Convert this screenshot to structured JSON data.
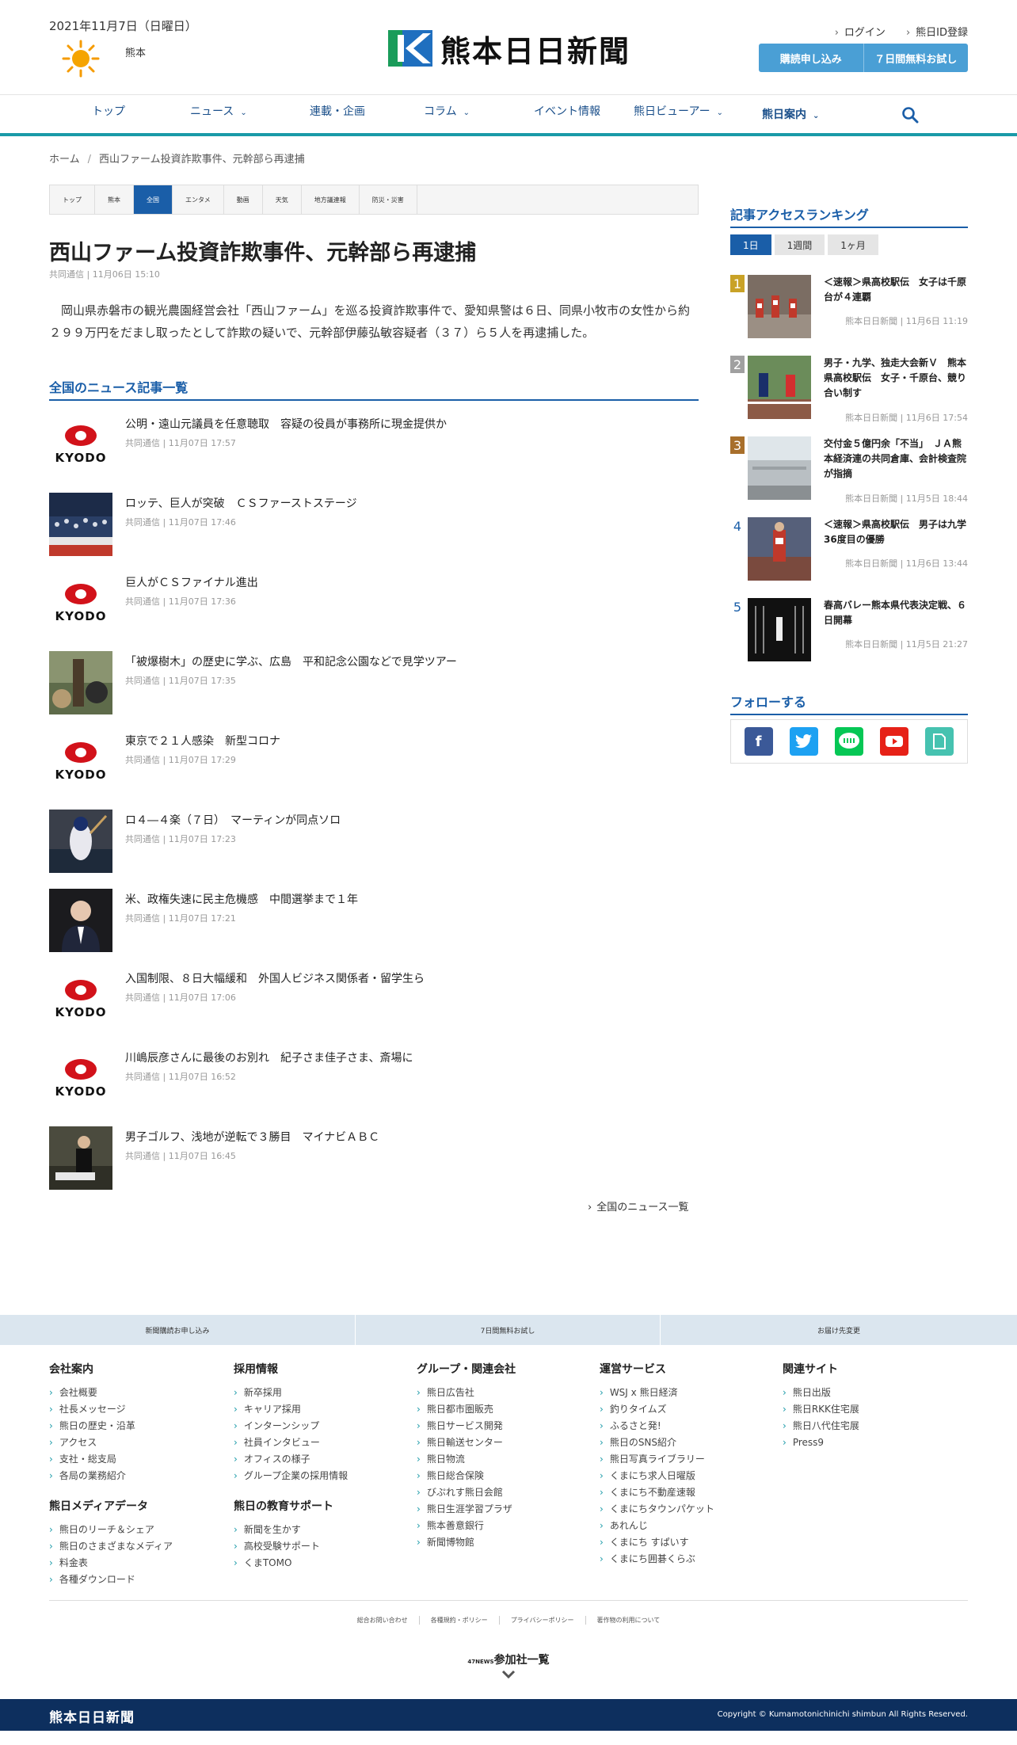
{
  "header": {
    "date": "2021年11月7日（日曜日）",
    "place": "熊本",
    "logo_text": "熊本日日新聞",
    "login": "ログイン",
    "id_register": "熊日ID登録",
    "subscribe": "購読申し込み",
    "trial": "７日間無料お試し",
    "brand_color": "#1a9aa8",
    "accent_color": "#1a5ea8"
  },
  "nav": {
    "items": [
      {
        "label": "トップ"
      },
      {
        "label": "ニュース",
        "chevron": "⌄"
      },
      {
        "label": "連載・企画"
      },
      {
        "label": "コラム",
        "chevron": "⌄"
      },
      {
        "label": "イベント情報"
      },
      {
        "label": "熊日ビューアー",
        "chevron": "⌄"
      },
      {
        "label": "熊日案内",
        "chevron": "⌄"
      }
    ]
  },
  "breadcrumb": {
    "home": "ホーム",
    "sep": "/",
    "current": "西山ファーム投資詐欺事件、元幹部ら再逮捕"
  },
  "category_tabs": [
    "トップ",
    "熊本",
    "全国",
    "エンタメ",
    "動画",
    "天気",
    "地方議連報",
    "防災・災害"
  ],
  "article": {
    "title": "西山ファーム投資詐欺事件、元幹部ら再逮捕",
    "meta": "共同通信 | 11月06日 15:10",
    "body": "岡山県赤磐市の観光農園経営会社「西山ファーム」を巡る投資詐欺事件で、愛知県警は６日、同県小牧市の女性から約２９９万円をだまし取ったとして詐欺の疑いで、元幹部伊藤弘敏容疑者（３７）ら５人を再逮捕した。"
  },
  "news_section": {
    "heading": "全国のニュース記事一覧",
    "kyodo_label": "KYODO",
    "items": [
      {
        "title": "公明・遠山元議員を任意聴取　容疑の役員が事務所に現金提供か",
        "meta": "共同通信 | 11月07日 17:57",
        "thumb": "kyodo"
      },
      {
        "title": "ロッテ、巨人が突破　ＣＳファーストステージ",
        "meta": "共同通信 | 11月07日 17:46",
        "thumb": "stadium"
      },
      {
        "title": "巨人がＣＳファイナル進出",
        "meta": "共同通信 | 11月07日 17:36",
        "thumb": "kyodo"
      },
      {
        "title": "「被爆樹木」の歴史に学ぶ、広島　平和記念公園などで見学ツアー",
        "meta": "共同通信 | 11月07日 17:35",
        "thumb": "tree"
      },
      {
        "title": "東京で２１人感染　新型コロナ",
        "meta": "共同通信 | 11月07日 17:29",
        "thumb": "kyodo"
      },
      {
        "title": "ロ４―４楽（７日）　マーティンが同点ソロ",
        "meta": "共同通信 | 11月07日 17:23",
        "thumb": "baseball"
      },
      {
        "title": "米、政権失速に民主危機感　中間選挙まで１年",
        "meta": "共同通信 | 11月07日 17:21",
        "thumb": "person"
      },
      {
        "title": "入国制限、８日大幅緩和　外国人ビジネス関係者・留学生ら",
        "meta": "共同通信 | 11月07日 17:06",
        "thumb": "kyodo"
      },
      {
        "title": "川嶋辰彦さんに最後のお別れ　紀子さま佳子さま、斎場に",
        "meta": "共同通信 | 11月07日 16:52",
        "thumb": "kyodo"
      },
      {
        "title": "男子ゴルフ、浅地が逆転で３勝目　マイナビＡＢＣ",
        "meta": "共同通信 | 11月07日 16:45",
        "thumb": "golf"
      }
    ],
    "more": "全国のニュース一覧"
  },
  "ranking": {
    "heading": "記事アクセスランキング",
    "tabs": [
      "1日",
      "1週間",
      "1ヶ月"
    ],
    "items": [
      {
        "num": "1",
        "title": "＜速報＞県高校駅伝　女子は千原台が４連覇",
        "meta": "熊本日日新聞 | 11月6日 11:19",
        "color": "#c9a227"
      },
      {
        "num": "2",
        "title": "男子・九学、独走大会新Ｖ　熊本県高校駅伝　女子・千原台、競り合い制す",
        "meta": "熊本日日新聞 | 11月6日 17:54",
        "color": "#a0a0a0"
      },
      {
        "num": "3",
        "title": "交付金５億円余「不当」　ＪＡ熊本経済連の共同倉庫、会計検査院が指摘",
        "meta": "熊本日日新聞 | 11月5日 18:44",
        "color": "#a86f2b"
      },
      {
        "num": "4",
        "title": "＜速報＞県高校駅伝　男子は九学36度目の優勝",
        "meta": "熊本日日新聞 | 11月6日 13:44",
        "color": ""
      },
      {
        "num": "5",
        "title": "春高バレー熊本県代表決定戦、６日開幕",
        "meta": "熊本日日新聞 | 11月5日 21:27",
        "color": ""
      }
    ]
  },
  "follow": {
    "heading": "フォローする"
  },
  "footer": {
    "bar": [
      "新聞購読お申し込み",
      "7日間無料お試し",
      "お届け先変更"
    ],
    "columns": [
      {
        "title": "会社案内",
        "items": [
          "会社概要",
          "社長メッセージ",
          "熊日の歴史・沿革",
          "アクセス",
          "支社・総支局",
          "各局の業務紹介"
        ]
      },
      {
        "title": "採用情報",
        "items": [
          "新卒採用",
          "キャリア採用",
          "インターンシップ",
          "社員インタビュー",
          "オフィスの様子",
          "グループ企業の採用情報"
        ]
      },
      {
        "title": "グループ・関連会社",
        "items": [
          "熊日広告社",
          "熊日都市圏販売",
          "熊日サービス開発",
          "熊日輸送センター",
          "熊日物流",
          "熊日総合保険",
          "びぷれす熊日会館",
          "熊日生涯学習プラザ",
          "熊本善意銀行",
          "新聞博物館"
        ]
      },
      {
        "title": "運営サービス",
        "items": [
          "WSJ x 熊日経済",
          "釣りタイムズ",
          "ふるさと発!",
          "熊日のSNS紹介",
          "熊日写真ライブラリー",
          "くまにち求人日曜版",
          "くまにち不動産速報",
          "くまにちタウンパケット",
          "あれんじ",
          "くまにち すぱいす",
          "くまにち囲碁くらぶ"
        ]
      },
      {
        "title": "関連サイト",
        "items": [
          "熊日出版",
          "熊日RKK住宅展",
          "熊日八代住宅展",
          "Press9"
        ]
      },
      {
        "title": "熊日メディアデータ",
        "items": [
          "熊日のリーチ＆シェア",
          "熊日のさまざまなメディア",
          "料金表",
          "各種ダウンロード"
        ]
      },
      {
        "title": "熊日の教育サポート",
        "items": [
          "新聞を生かす",
          "高校受験サポート",
          "くまTOMO"
        ]
      }
    ],
    "legal": [
      "総合お問い合わせ",
      "各種規約・ポリシー",
      "プライバシーポリシー",
      "著作物の利用について"
    ],
    "members_prefix": "47NEWS",
    "members": "参加社一覧",
    "bottom_logo": "熊本日日新聞",
    "copyright": "Copyright © Kumamotonichinichi shimbun All Rights Reserved."
  }
}
